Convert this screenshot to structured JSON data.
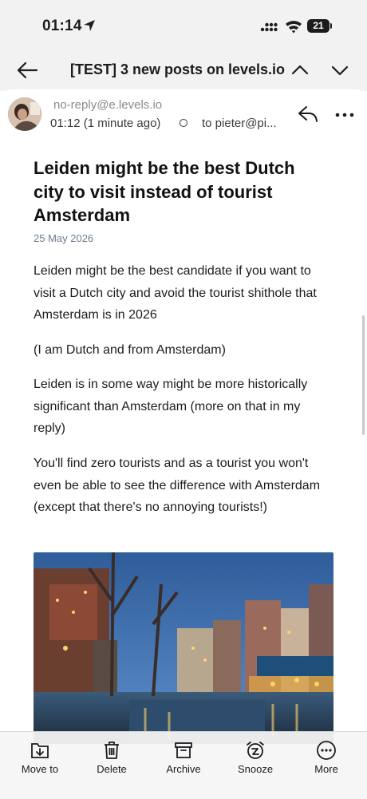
{
  "status_bar": {
    "time": "01:14",
    "battery": "21"
  },
  "nav": {
    "title": "[TEST] 3 new posts on levels.io"
  },
  "email": {
    "from": "no-reply@e.levels.io",
    "time": "01:12 (1 minute ago)",
    "to": "to pieter@pi..."
  },
  "post": {
    "title": "Leiden might be the best Dutch city to visit instead of tourist Amsterdam",
    "date": "25 May 2026",
    "paragraphs": [
      "Leiden might be the best candidate if you want to visit a Dutch city and avoid the tourist shithole that Amsterdam is in 2026",
      "(I am Dutch and from Amsterdam)",
      "Leiden is in some way might be more historically significant than Amsterdam (more on that in my reply)",
      "You'll find zero tourists and as a tourist you won't even be able to see the difference with Amsterdam (except that there's no annoying tourists!)"
    ]
  },
  "toolbar": [
    {
      "label": "Move to",
      "icon": "move-to-icon"
    },
    {
      "label": "Delete",
      "icon": "trash-icon"
    },
    {
      "label": "Archive",
      "icon": "archive-icon"
    },
    {
      "label": "Snooze",
      "icon": "alarm-icon"
    },
    {
      "label": "More",
      "icon": "more-icon"
    }
  ],
  "colors": {
    "date": "#6e7d8c",
    "sender": "#8a8a8e",
    "background": "#f2f2f2"
  }
}
